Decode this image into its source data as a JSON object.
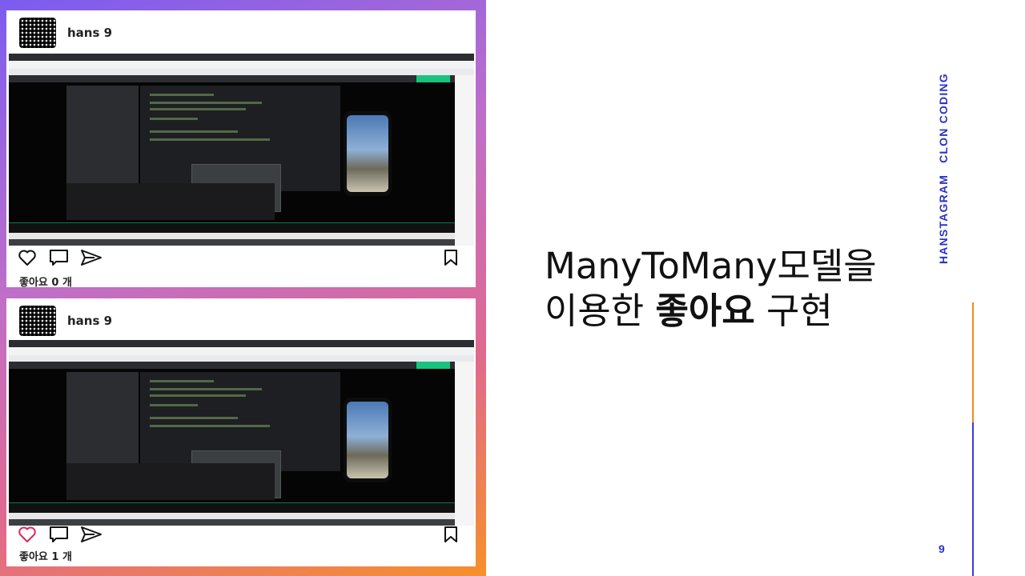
{
  "slide": {
    "title_part1": "ManyToMany모델을",
    "title_part2": "이용한 ",
    "title_bold": "좋아요",
    "title_part3": " 구현",
    "side_label_1": "HANSTAGRAM",
    "side_label_2": "CLON CODING",
    "page_number": "9"
  },
  "posts": [
    {
      "username": "hans 9",
      "liked": false,
      "likes_text": "좋아요 0 개"
    },
    {
      "username": "hans 9",
      "liked": true,
      "likes_text": "좋아요 1 개"
    }
  ],
  "icons": {
    "like": "heart-icon",
    "comment": "comment-icon",
    "share": "send-icon",
    "save": "bookmark-icon"
  },
  "colors": {
    "accent_blue": "#2b33c8",
    "accent_orange": "#f4891f",
    "like_red": "#e0245e"
  }
}
